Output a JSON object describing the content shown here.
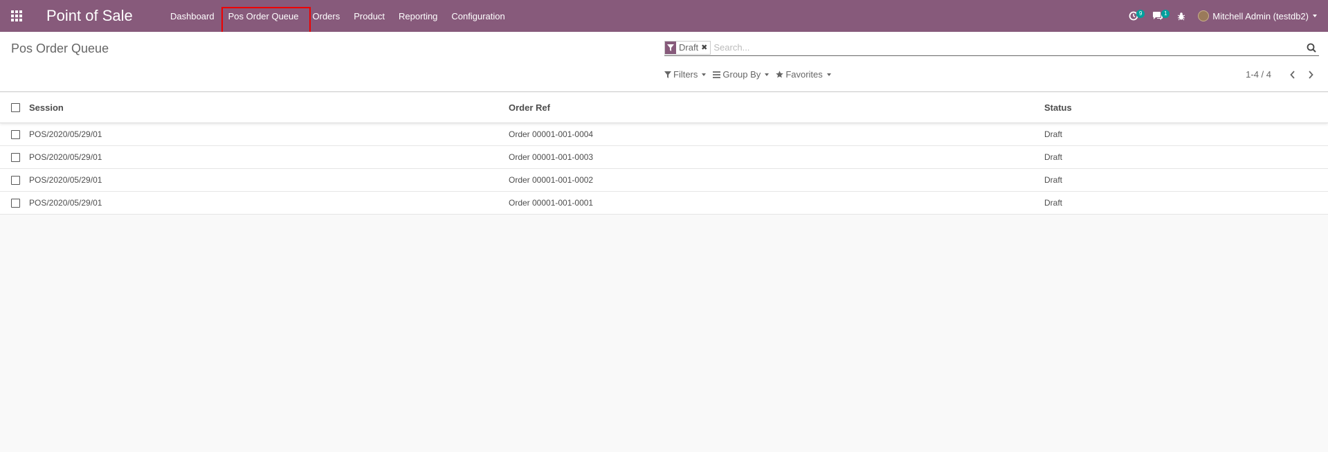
{
  "app": {
    "title": "Point of Sale"
  },
  "menu": [
    {
      "label": "Dashboard"
    },
    {
      "label": "Pos Order Queue"
    },
    {
      "label": "Orders"
    },
    {
      "label": "Product"
    },
    {
      "label": "Reporting"
    },
    {
      "label": "Configuration"
    }
  ],
  "systray": {
    "activity_count": "9",
    "messages_count": "1",
    "user_name": "Mitchell Admin (testdb2)"
  },
  "breadcrumb": "Pos Order Queue",
  "search": {
    "facet": "Draft",
    "placeholder": "Search..."
  },
  "filters": {
    "filters_label": "Filters",
    "groupby_label": "Group By",
    "favorites_label": "Favorites"
  },
  "pager": {
    "value": "1-4 / 4"
  },
  "table": {
    "headers": {
      "session": "Session",
      "order_ref": "Order Ref",
      "status": "Status"
    },
    "rows": [
      {
        "session": "POS/2020/05/29/01",
        "order_ref": "Order 00001-001-0004",
        "status": "Draft"
      },
      {
        "session": "POS/2020/05/29/01",
        "order_ref": "Order 00001-001-0003",
        "status": "Draft"
      },
      {
        "session": "POS/2020/05/29/01",
        "order_ref": "Order 00001-001-0002",
        "status": "Draft"
      },
      {
        "session": "POS/2020/05/29/01",
        "order_ref": "Order 00001-001-0001",
        "status": "Draft"
      }
    ]
  },
  "colors": {
    "navbar": "#875a7b",
    "badge": "#00a09d",
    "highlight": "#ee0000"
  }
}
